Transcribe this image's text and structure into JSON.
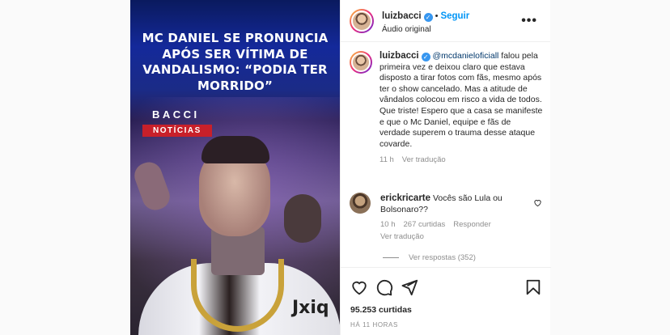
{
  "media": {
    "headline": "MC DANIEL SE PRONUNCIA APÓS SER VÍTIMA DE VANDALISMO: “PODIA TER MORRIDO”",
    "brand": "BACCI",
    "tag": "NOTÍCIAS",
    "shirt_text": "Jxiq"
  },
  "header": {
    "username": "luizbacci",
    "dot": "•",
    "follow_label": "Seguir",
    "audio": "Áudio original",
    "more_label": "•••"
  },
  "caption": {
    "username": "luizbacci",
    "mention": "@mcdanieloficiall",
    "text": " falou pela primeira vez e deixou claro que estava disposto a tirar fotos com fãs, mesmo após ter o show cancelado. Mas a atitude de vândalos colocou em risco a vida de todos. Que triste! Espero que a casa se manifeste e que o Mc Daniel, equipe e fãs de verdade superem o trauma desse ataque covarde.",
    "time": "11 h",
    "translate": "Ver tradução"
  },
  "comment": {
    "username": "erickricarte",
    "text": " Vocês são Lula ou Bolsonaro??",
    "time": "10 h",
    "likes": "267 curtidas",
    "reply": "Responder",
    "translate": "Ver tradução",
    "view_replies": "Ver respostas (352)"
  },
  "footer": {
    "likes": "95.253 curtidas",
    "timestamp": "HÁ 11 HORAS"
  },
  "icons": [
    "heart-icon",
    "comment-icon",
    "share-icon",
    "bookmark-icon",
    "verified-icon",
    "more-icon"
  ]
}
